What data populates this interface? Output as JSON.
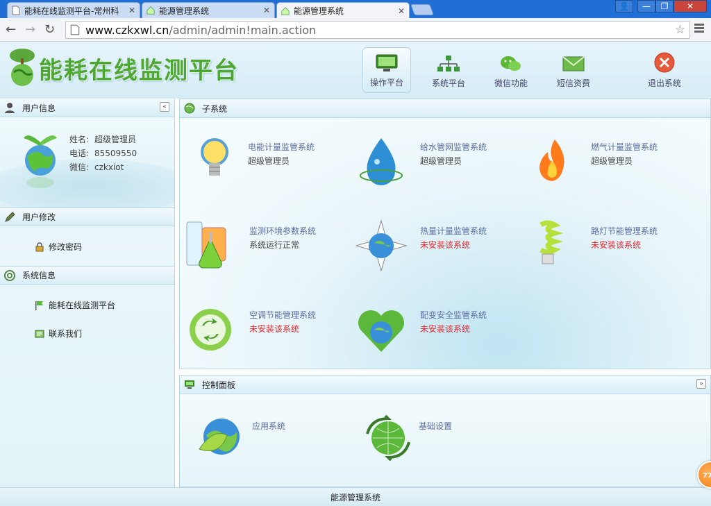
{
  "browser": {
    "tabs": [
      {
        "title": "能耗在线监测平台-常州科",
        "active": false
      },
      {
        "title": "能源管理系统",
        "active": false
      },
      {
        "title": "能源管理系统",
        "active": true
      }
    ],
    "url_host": "www.czkxwl.cn",
    "url_path": "/admin/admin!main.action"
  },
  "header": {
    "brand": "能耗在线监测平台",
    "nav": [
      {
        "label": "操作平台",
        "icon": "monitor-icon",
        "active": true
      },
      {
        "label": "系统平台",
        "icon": "sitemap-icon",
        "active": false
      },
      {
        "label": "微信功能",
        "icon": "wechat-icon",
        "active": false
      },
      {
        "label": "短信资费",
        "icon": "envelope-icon",
        "active": false
      },
      {
        "label": "退出系统",
        "icon": "exit-icon",
        "active": false
      }
    ]
  },
  "sidebar": {
    "user_info_title": "用户信息",
    "user": {
      "name_key": "姓名:",
      "name": "超级管理员",
      "phone_key": "电话:",
      "phone": "85509550",
      "wechat_key": "微信:",
      "wechat": "czkxiot"
    },
    "user_edit_title": "用户修改",
    "change_password": "修改密码",
    "system_info_title": "系统信息",
    "platform_link": "能耗在线监测平台",
    "contact_link": "联系我们"
  },
  "subsystems": {
    "title": "子系统",
    "items": [
      {
        "name": "电能计量监管系统",
        "status": "超级管理员",
        "warn": false,
        "icon": "lightbulb-icon"
      },
      {
        "name": "给水管网监管系统",
        "status": "超级管理员",
        "warn": false,
        "icon": "water-drop-icon"
      },
      {
        "name": "燃气计量监管系统",
        "status": "超级管理员",
        "warn": false,
        "icon": "flame-icon"
      },
      {
        "name": "监测环境参数系统",
        "status": "系统运行正常",
        "warn": false,
        "icon": "beakers-icon"
      },
      {
        "name": "热量计量监管系统",
        "status": "未安装该系统",
        "warn": true,
        "icon": "compass-globe-icon"
      },
      {
        "name": "路灯节能管理系统",
        "status": "未安装该系统",
        "warn": true,
        "icon": "cfl-bulb-icon"
      },
      {
        "name": "空调节能管理系统",
        "status": "未安装该系统",
        "warn": true,
        "icon": "recycle-icon"
      },
      {
        "name": "配变安全监管系统",
        "status": "未安装该系统",
        "warn": true,
        "icon": "heart-globe-icon"
      }
    ]
  },
  "control_panel": {
    "title": "控制面板",
    "items": [
      {
        "label": "应用系统",
        "icon": "leaf-globe-icon"
      },
      {
        "label": "基础设置",
        "icon": "globe-arrows-icon"
      }
    ]
  },
  "footer": {
    "text": "能源管理系统"
  },
  "float_badge": {
    "text": "77"
  },
  "colors": {
    "brand_green": "#4da832",
    "link_blue": "#5a6da0",
    "warn_red": "#e0282e",
    "chrome_blue": "#1f6fd6"
  }
}
